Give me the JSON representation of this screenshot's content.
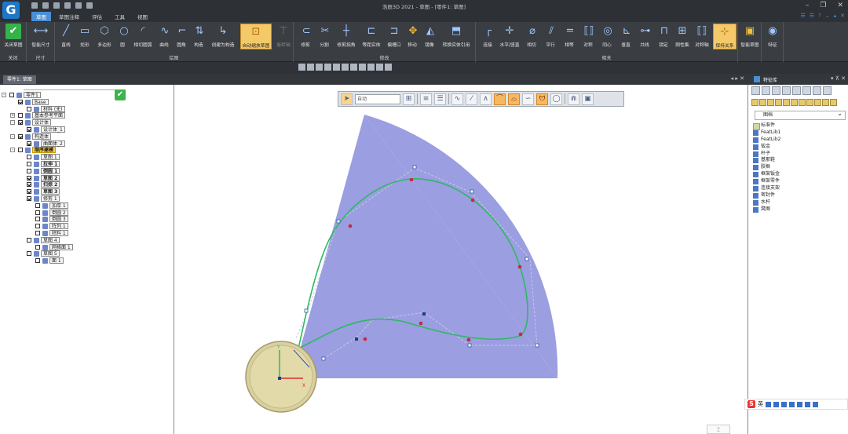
{
  "app": {
    "title": "浩辰3D 2021 - 草图 - [零件1: 草图]",
    "logo_icon": "logo-icon"
  },
  "tabs": [
    "草图",
    "草图注释",
    "评估",
    "工具",
    "视图"
  ],
  "active_tab": "草图",
  "ribbon": {
    "groups": {
      "close": "关闭",
      "dimension": "尺寸",
      "draw": "绘图",
      "modify": "修改",
      "relation": "相关"
    },
    "tools": {
      "close_sketch": "关闭草图",
      "smart_dim": "智能尺寸",
      "line": "直线",
      "rectangle": "矩形",
      "polygon": "多边形",
      "circle": "圆",
      "tangent_arc": "相切圆弧",
      "curve": "曲线",
      "fillet": "圆角",
      "construction": "构造",
      "create_construction": "创建为构造",
      "auto_trim_sketch": "自动缩放草图",
      "rotate": "旋转轴",
      "trim": "修剪",
      "split": "分割",
      "trim_corner": "修剪拐角",
      "equidistant": "等距实体",
      "offset_edge": "偏槽口",
      "move": "移动",
      "mirror": "镜像",
      "convert": "转换实体引用",
      "connect": "连接",
      "horiz_vert": "水平/竖直",
      "tangent": "相切",
      "parallel": "平行",
      "equal": "相等",
      "symmetric": "对称",
      "concentric": "同心",
      "perpendicular": "垂直",
      "collinear": "共线",
      "lock": "锁定",
      "rigid": "刚性集",
      "symmetric_axis": "对称轴",
      "keep_relation": "保持关系",
      "smart_sketch": "智能草图",
      "feature": "特征"
    }
  },
  "left_panel": {
    "doc_tab": "零件1: 草图",
    "tree": [
      {
        "label": "零件1",
        "indent": 0,
        "toggle": "-",
        "check": false,
        "style": ""
      },
      {
        "label": "Base",
        "indent": 1,
        "toggle": "",
        "check": true,
        "style": ""
      },
      {
        "label": "材料 (无)",
        "indent": 2,
        "toggle": "",
        "check": false,
        "style": ""
      },
      {
        "label": "基本参考平面",
        "indent": 1,
        "toggle": "+",
        "check": false,
        "style": ""
      },
      {
        "label": "设计体",
        "indent": 1,
        "toggle": "-",
        "check": true,
        "style": ""
      },
      {
        "label": "设计体_1",
        "indent": 2,
        "toggle": "",
        "check": true,
        "style": ""
      },
      {
        "label": "构造体",
        "indent": 1,
        "toggle": "-",
        "check": true,
        "style": ""
      },
      {
        "label": "曲面体_2",
        "indent": 2,
        "toggle": "",
        "check": true,
        "style": ""
      },
      {
        "label": "顺序建模",
        "indent": 1,
        "toggle": "-",
        "check": false,
        "style": "hl"
      },
      {
        "label": "草图 1",
        "indent": 2,
        "toggle": "",
        "check": false,
        "style": ""
      },
      {
        "label": "拉伸 1",
        "indent": 2,
        "toggle": "",
        "check": false,
        "style": "bold"
      },
      {
        "label": "倒圆 1",
        "indent": 2,
        "toggle": "",
        "check": false,
        "style": "bold"
      },
      {
        "label": "草图 2",
        "indent": 2,
        "toggle": "",
        "check": true,
        "style": "bold"
      },
      {
        "label": "扫掠 2",
        "indent": 2,
        "toggle": "",
        "check": true,
        "style": "bold"
      },
      {
        "label": "草图 3",
        "indent": 2,
        "toggle": "",
        "check": true,
        "style": "bold"
      },
      {
        "label": "修剪 1",
        "indent": 2,
        "toggle": "",
        "check": true,
        "style": ""
      },
      {
        "label": "加厚 1",
        "indent": 3,
        "toggle": "",
        "check": false,
        "style": ""
      },
      {
        "label": "倒圆 2",
        "indent": 3,
        "toggle": "",
        "check": false,
        "style": ""
      },
      {
        "label": "倒圆 3",
        "indent": 3,
        "toggle": "",
        "check": false,
        "style": ""
      },
      {
        "label": "阵列 1",
        "indent": 3,
        "toggle": "",
        "check": false,
        "style": ""
      },
      {
        "label": "除料 1",
        "indent": 3,
        "toggle": "",
        "check": false,
        "style": ""
      },
      {
        "label": "草图 4",
        "indent": 2,
        "toggle": "",
        "check": false,
        "style": ""
      },
      {
        "label": "网格面 1",
        "indent": 3,
        "toggle": "",
        "check": false,
        "style": ""
      },
      {
        "label": "草图 5",
        "indent": 2,
        "toggle": "",
        "check": false,
        "style": ""
      },
      {
        "label": "面 1",
        "indent": 3,
        "toggle": "",
        "check": false,
        "style": ""
      }
    ]
  },
  "sketchbar": {
    "mode": "自动"
  },
  "right_panel": {
    "title": "特征库",
    "library": "图档",
    "items": [
      "标准件",
      "FeatLib1",
      "FeatLib2",
      "钣金",
      "杆子",
      "基那鞋",
      "胶框",
      "框架钣金",
      "框架零件",
      "连接支架",
      "密封件",
      "水杆",
      "凳图"
    ]
  },
  "ime": {
    "lang": "英"
  },
  "colors": {
    "sector_fill": "#9b9ee0",
    "curve": "#2fb865",
    "control_polygon": "#c8c8e8",
    "selection_bg": "#ffd24a",
    "accent": "#4a8fd4"
  }
}
